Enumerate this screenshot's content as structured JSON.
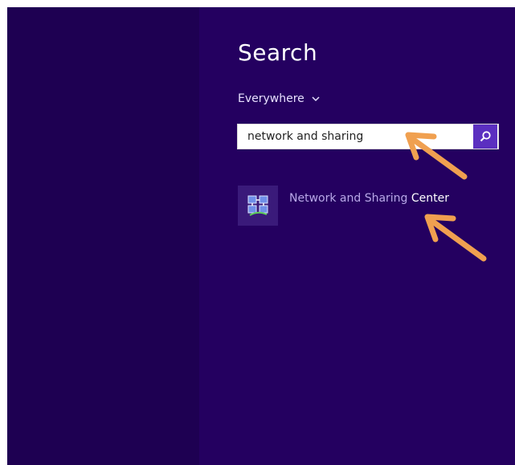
{
  "search": {
    "title": "Search",
    "scope_label": "Everywhere",
    "query_value": "network and sharing"
  },
  "results": [
    {
      "label_prefix": "Network and Sharing ",
      "label_highlight": "Center",
      "icon": "network-sharing-icon"
    }
  ],
  "colors": {
    "background": "#240060",
    "left_pane": "#1e0052",
    "search_button": "#5b2fc0",
    "annotation_arrow": "#f0a050"
  },
  "annotations": {
    "arrow_1_target": "search-input",
    "arrow_2_target": "search-result-network-and-sharing-center"
  }
}
